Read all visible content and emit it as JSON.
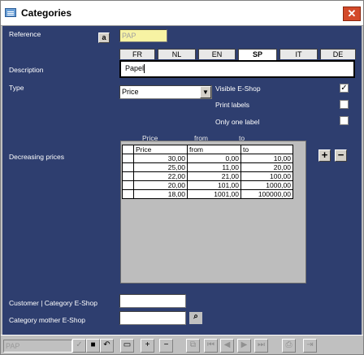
{
  "window": {
    "title": "Categories"
  },
  "form": {
    "reference_label": "Reference",
    "reference_value": "PAP",
    "ref_button": "a",
    "description_label": "Description",
    "tabs": [
      "FR",
      "NL",
      "EN",
      "SP",
      "IT",
      "DE"
    ],
    "active_tab": "SP",
    "description_value": "Papel",
    "type_label": "Type",
    "type_value": "Price",
    "visible_eshop_label": "Visible E-Shop",
    "visible_eshop_checked": "✓",
    "print_labels_label": "Print labels",
    "only_one_label_label": "Only one label",
    "col_price": "Price",
    "col_from": "from",
    "col_to": "to",
    "decreasing_label": "Decreasing prices",
    "plus_btn": "+",
    "minus_btn": "−",
    "customer_label": "Customer | Category E-Shop",
    "mother_label": "Category mother E-Shop"
  },
  "grid": {
    "headers": [
      "Price",
      "from",
      "to"
    ],
    "rows": [
      [
        "30,00",
        "0,00",
        "10,00"
      ],
      [
        "25,00",
        "11,00",
        "20,00"
      ],
      [
        "22,00",
        "21,00",
        "100,00"
      ],
      [
        "20,00",
        "101,00",
        "1000,00"
      ],
      [
        "18,00",
        "1001,00",
        "100000,00"
      ]
    ]
  },
  "status": {
    "field": "PAP"
  }
}
